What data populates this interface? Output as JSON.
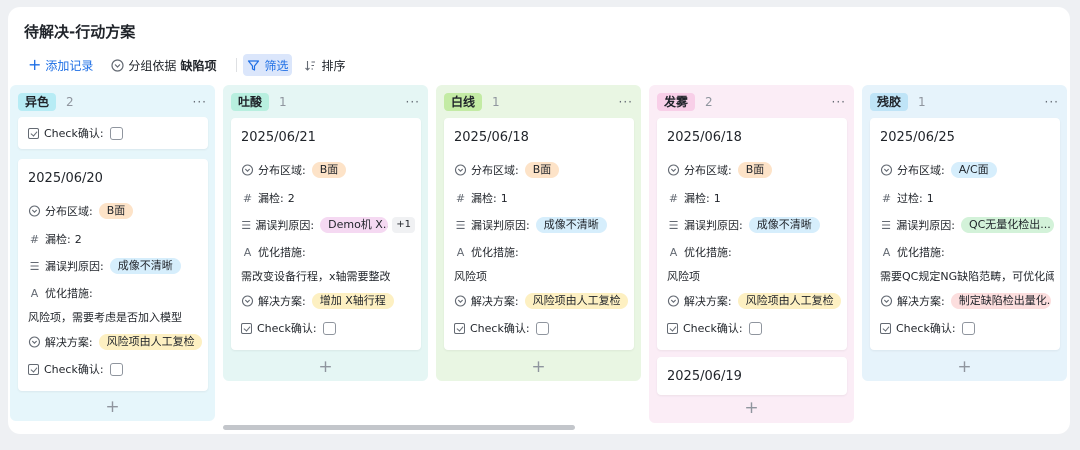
{
  "header": {
    "title": "待解决-行动方案"
  },
  "toolbar": {
    "add_label": "添加记录",
    "group_label": "分组依据",
    "group_value": "缺陷项",
    "filter_label": "筛选",
    "sort_label": "排序"
  },
  "colors": {
    "yise_bg": "#e6f6fb",
    "yise_tag": "#b7ecf5",
    "tusuan_bg": "#e5f6f4",
    "tusuan_tag": "#b8efdf",
    "baixian_bg": "#e9f6e3",
    "baixian_tag": "#c3eba4",
    "fawu_bg": "#fbedf6",
    "fawu_tag": "#f8cfe8",
    "canjiao_bg": "#e6f3fb",
    "canjiao_tag": "#bfe4f7",
    "pill_orange": "#fde3c8",
    "pill_blue": "#d6eefc",
    "pill_pink": "#f5d9f2",
    "pill_yellow": "#fdf0c2",
    "pill_green": "#d3f2d9",
    "pill_red": "#fcdede"
  },
  "labels": {
    "check": "Check确认:",
    "area": "分布区域:",
    "miss": "漏检:",
    "over": "过检:",
    "reason": "漏误判原因:",
    "measure": "优化措施:",
    "solution": "解决方案:"
  },
  "columns": [
    {
      "name": "异色",
      "count": "2"
    },
    {
      "name": "吐酸",
      "count": "1"
    },
    {
      "name": "白线",
      "count": "1"
    },
    {
      "name": "发雾",
      "count": "2"
    },
    {
      "name": "残胶",
      "count": "1"
    }
  ],
  "cards": {
    "yise": {
      "date": "2025/06/20",
      "area": "B面",
      "miss": "2",
      "reason": "成像不清晰",
      "measure": "风险项，需要考虑是否加入模型",
      "solution": "风险项由人工复检"
    },
    "tusuan": {
      "date": "2025/06/21",
      "area": "B面",
      "miss": "2",
      "reason": "Demo机 X...",
      "reason_more": "+1",
      "measure": "需改变设备行程，x轴需要整改",
      "solution": "增加 X轴行程"
    },
    "baixian": {
      "date": "2025/06/18",
      "area": "B面",
      "miss": "1",
      "reason": "成像不清晰",
      "measure": "风险项",
      "solution": "风险项由人工复检"
    },
    "fawu": {
      "date": "2025/06/18",
      "area": "B面",
      "miss": "1",
      "reason": "成像不清晰",
      "measure": "风险项",
      "solution": "风险项由人工复检",
      "date2": "2025/06/19"
    },
    "canjiao": {
      "date": "2025/06/25",
      "area": "A/C面",
      "over": "1",
      "reason": "QC无量化检出...",
      "measure": "需要QC规定NG缺陷范畴，可优化阈值",
      "solution": "制定缺陷检出量化..."
    }
  }
}
